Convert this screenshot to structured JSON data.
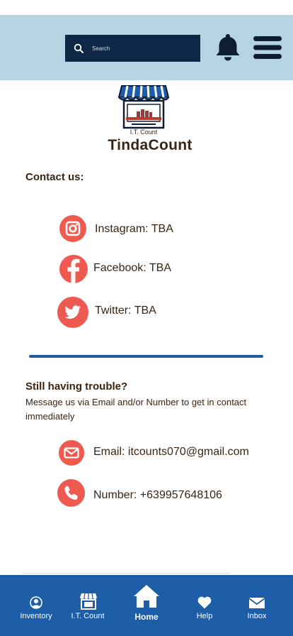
{
  "header": {
    "search_placeholder": "Search",
    "bell_icon": "bell-icon",
    "menu_icon": "hamburger-menu-icon"
  },
  "brand": {
    "logo_caption": "I.T. Count",
    "name": "TindaCount"
  },
  "contact": {
    "title": "Contact us:",
    "items": [
      {
        "icon": "instagram-icon",
        "label": "Instagram: TBA"
      },
      {
        "icon": "facebook-icon",
        "label": "Facebook: TBA"
      },
      {
        "icon": "twitter-icon",
        "label": "Twitter: TBA"
      }
    ]
  },
  "trouble": {
    "title": "Still having trouble?",
    "text": "Message us via Email and/or Number to get in contact immediately",
    "items": [
      {
        "icon": "email-icon",
        "label": "Email: itcounts070@gmail.com"
      },
      {
        "icon": "phone-icon",
        "label": "Number: +639957648106"
      }
    ]
  },
  "nav": {
    "items": [
      {
        "icon": "user-icon",
        "label": "Inventory"
      },
      {
        "icon": "store-icon",
        "label": "I.T. Count"
      },
      {
        "icon": "home-icon",
        "label": "Home",
        "active": true
      },
      {
        "icon": "heart-icon",
        "label": "Help"
      },
      {
        "icon": "envelope-icon",
        "label": "Inbox"
      }
    ]
  },
  "colors": {
    "header_bg": "#b3d4e0",
    "search_bg": "#0f2747",
    "accent_red": "#ee5a4f",
    "nav_bg": "#1e5da8",
    "text_brown": "#3a2414"
  }
}
